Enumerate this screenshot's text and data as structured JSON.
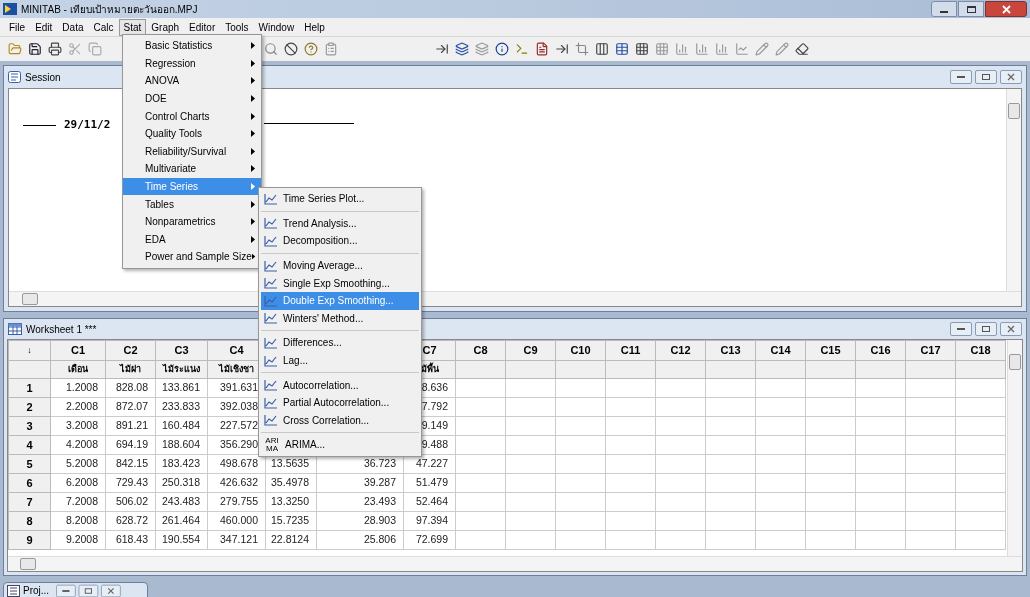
{
  "window": {
    "title": "MINITAB - เทียบเป้าหมายตะวันออก.MPJ"
  },
  "menu_bar": [
    {
      "label": "File",
      "selected": false
    },
    {
      "label": "Edit",
      "selected": false
    },
    {
      "label": "Data",
      "selected": false
    },
    {
      "label": "Calc",
      "selected": false
    },
    {
      "label": "Stat",
      "selected": true
    },
    {
      "label": "Graph",
      "selected": false
    },
    {
      "label": "Editor",
      "selected": false
    },
    {
      "label": "Tools",
      "selected": false
    },
    {
      "label": "Window",
      "selected": false
    },
    {
      "label": "Help",
      "selected": false
    }
  ],
  "stat_menu": [
    {
      "label": "Basic Statistics",
      "selected": false
    },
    {
      "label": "Regression",
      "selected": false
    },
    {
      "label": "ANOVA",
      "selected": false
    },
    {
      "label": "DOE",
      "selected": false
    },
    {
      "label": "Control Charts",
      "selected": false
    },
    {
      "label": "Quality Tools",
      "selected": false
    },
    {
      "label": "Reliability/Survival",
      "selected": false
    },
    {
      "label": "Multivariate",
      "selected": false
    },
    {
      "label": "Time Series",
      "selected": true
    },
    {
      "label": "Tables",
      "selected": false
    },
    {
      "label": "Nonparametrics",
      "selected": false
    },
    {
      "label": "EDA",
      "selected": false
    },
    {
      "label": "Power and Sample Size",
      "selected": false
    }
  ],
  "time_series_menu": [
    [
      {
        "label": "Time Series Plot...",
        "selected": false
      }
    ],
    [
      {
        "label": "Trend Analysis...",
        "selected": false
      },
      {
        "label": "Decomposition...",
        "selected": false
      }
    ],
    [
      {
        "label": "Moving Average...",
        "selected": false
      },
      {
        "label": "Single Exp Smoothing...",
        "selected": false
      },
      {
        "label": "Double Exp Smoothing...",
        "selected": true
      },
      {
        "label": "Winters' Method...",
        "selected": false
      }
    ],
    [
      {
        "label": "Differences...",
        "selected": false
      },
      {
        "label": "Lag...",
        "selected": false
      }
    ],
    [
      {
        "label": "Autocorrelation...",
        "selected": false
      },
      {
        "label": "Partial Autocorrelation...",
        "selected": false
      },
      {
        "label": "Cross Correlation...",
        "selected": false
      }
    ],
    [
      {
        "label": "ARIMA...",
        "selected": false,
        "icon_text": "ARI MA"
      }
    ]
  ],
  "session": {
    "title": "Session",
    "date": "29/11/2"
  },
  "worksheet": {
    "title": "Worksheet 1 ***",
    "corner": "↓",
    "columns": [
      {
        "id": "C1",
        "name": "เดือน"
      },
      {
        "id": "C2",
        "name": "ไม้ฝา"
      },
      {
        "id": "C3",
        "name": "ไม้ระแนง"
      },
      {
        "id": "C4",
        "name": "ไม้เชิงชา"
      },
      {},
      {},
      {
        "id": "C7",
        "name": "ม้พื้น"
      },
      {
        "id": "C8"
      },
      {
        "id": "C9"
      },
      {
        "id": "C10"
      },
      {
        "id": "C11"
      },
      {
        "id": "C12"
      },
      {
        "id": "C13"
      },
      {
        "id": "C14"
      },
      {
        "id": "C15"
      },
      {
        "id": "C16"
      },
      {
        "id": "C17"
      },
      {
        "id": "C18"
      }
    ],
    "rows": [
      {
        "number": "1",
        "cells": [
          "1.2008",
          "828.08",
          "133.861",
          "391.631",
          null,
          null,
          "8.636"
        ]
      },
      {
        "number": "2",
        "cells": [
          "2.2008",
          "872.07",
          "233.833",
          "392.038",
          null,
          null,
          "7.792"
        ]
      },
      {
        "number": "3",
        "cells": [
          "3.2008",
          "891.21",
          "160.484",
          "227.572",
          null,
          null,
          "9.149"
        ]
      },
      {
        "number": "4",
        "cells": [
          "4.2008",
          "694.19",
          "188.604",
          "356.290",
          null,
          null,
          "9.488"
        ]
      },
      {
        "number": "5",
        "cells": [
          "5.2008",
          "842.15",
          "183.423",
          "498.678",
          "13.5635",
          "36.723",
          "47.227"
        ]
      },
      {
        "number": "6",
        "cells": [
          "6.2008",
          "729.43",
          "250.318",
          "426.632",
          "35.4978",
          "39.287",
          "51.479"
        ]
      },
      {
        "number": "7",
        "cells": [
          "7.2008",
          "506.02",
          "243.483",
          "279.755",
          "13.3250",
          "23.493",
          "52.464"
        ]
      },
      {
        "number": "8",
        "cells": [
          "8.2008",
          "628.72",
          "261.464",
          "460.000",
          "15.7235",
          "28.903",
          "97.394"
        ]
      },
      {
        "number": "9",
        "cells": [
          "9.2008",
          "618.43",
          "190.554",
          "347.121",
          "22.8124",
          "25.806",
          "72.699"
        ]
      }
    ]
  },
  "taskbar": {
    "label": "Proj..."
  }
}
